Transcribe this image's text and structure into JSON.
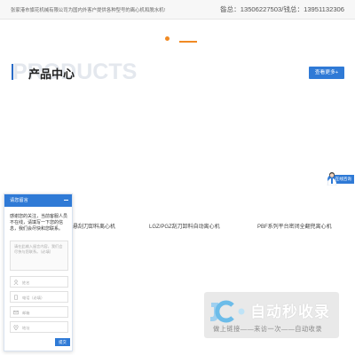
{
  "topbar": {
    "tagline": "张家港市旗花机械有限公司为国内外客户提供各种型号的离心机和脱水机!",
    "phone": "昝总：13506227503/钱总：13951132306"
  },
  "section": {
    "ghost_title": "PRODUCTS",
    "title": "产品中心",
    "more_button": "查看更多+"
  },
  "products": [
    {
      "name": "悬刮刀卸料离心机"
    },
    {
      "name": "LGZ/PGZ刮刀卸料自动离心机"
    },
    {
      "name": "PBF系列平台密闭全翻兜离心机"
    }
  ],
  "online_service": {
    "label": "在线咨询"
  },
  "message_panel": {
    "title": "请您留言",
    "intro": "感谢您的关注，当前客服人员不在线，请填写一下您的信息，我们会尽快和您联系。",
    "message_placeholder": "请在此输入留言内容，我们会尽快与您联系。（必填）",
    "fields": [
      {
        "placeholder": "姓名",
        "icon": "user-icon"
      },
      {
        "placeholder": "电话（必填）",
        "icon": "phone-icon"
      },
      {
        "placeholder": "邮箱",
        "icon": "mail-icon"
      },
      {
        "placeholder": "地址",
        "icon": "location-icon"
      }
    ],
    "submit": "提交"
  },
  "watermark": {
    "text": "自动秒收录",
    "sub": "做上链接——来访一次——自动收录"
  },
  "colors": {
    "accent_blue": "#2f7ad6",
    "accent_orange": "#f08a24"
  }
}
